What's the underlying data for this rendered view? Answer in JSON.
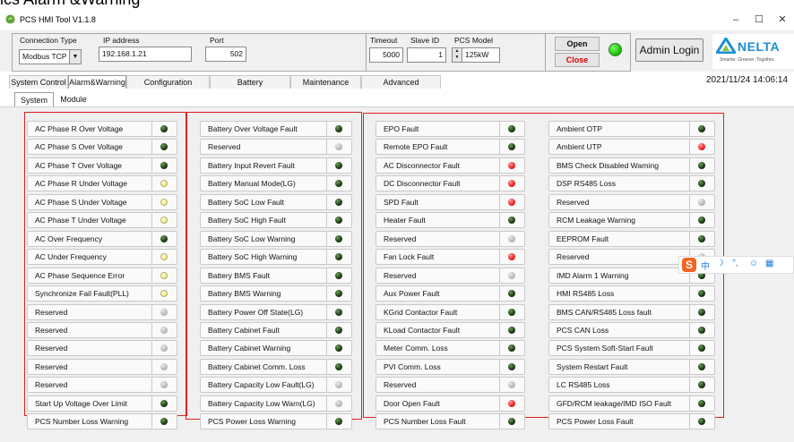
{
  "page_heading_cut": "ics Alarm &Warning",
  "window": {
    "title": "PCS HMI Tool V1.1.8",
    "controls": {
      "minimize": "–",
      "maximize": "☐",
      "close": "✕"
    }
  },
  "connection": {
    "type_label": "Connection Type",
    "type_value": "Modbus TCP",
    "ip_label": "IP address",
    "ip_value": "192.168.1.21",
    "port_label": "Port",
    "port_value": "502",
    "timeout_label": "Timeout",
    "timeout_value": "5000",
    "slave_label": "Slave ID",
    "slave_value": "1",
    "model_label": "PCS Model",
    "model_value": "125kW",
    "open_label": "Open",
    "close_label": "Close",
    "status_color": "#1cc60a"
  },
  "admin_login": "Admin Login",
  "brand": {
    "name": "NELTA",
    "tagline": "Smarter. Greener. Together."
  },
  "tabs": [
    "System Control",
    "Alarm&Warning",
    "Configuration",
    "Battery",
    "Maintenance",
    "Advanced"
  ],
  "active_tab": "Alarm&Warning",
  "datetime": "2021/11/24 14:06:14",
  "subtabs": [
    "System",
    "Module"
  ],
  "active_subtab": "System",
  "led_colors": {
    "dark": "#1a3a12",
    "gray": "#b8b8b8",
    "yellow": "#f2ee8a",
    "red": "#ee2222"
  },
  "columns": [
    {
      "items": [
        {
          "label": "AC Phase R Over Voltage",
          "state": "dark"
        },
        {
          "label": "AC Phase S Over Voltage",
          "state": "dark"
        },
        {
          "label": "AC Phase T Over Voltage",
          "state": "dark"
        },
        {
          "label": "AC Phase R Under Voltage",
          "state": "yellow"
        },
        {
          "label": "AC Phase S Under Voltage",
          "state": "yellow"
        },
        {
          "label": "AC Phase T Under Voltage",
          "state": "yellow"
        },
        {
          "label": "AC Over Frequency",
          "state": "dark"
        },
        {
          "label": "AC Under Frequency",
          "state": "yellow"
        },
        {
          "label": "AC Phase Sequence Error",
          "state": "yellow"
        },
        {
          "label": "Synchronize Fail Fault(PLL)",
          "state": "yellow"
        },
        {
          "label": "Reserved",
          "state": "gray"
        },
        {
          "label": "Reserved",
          "state": "gray"
        },
        {
          "label": "Reserved",
          "state": "gray"
        },
        {
          "label": "Reserved",
          "state": "gray"
        },
        {
          "label": "Reserved",
          "state": "gray"
        },
        {
          "label": "Start Up Voltage Over Limit",
          "state": "dark"
        },
        {
          "label": "PCS Number Loss Warning",
          "state": "dark"
        }
      ]
    },
    {
      "items": [
        {
          "label": "Battery Over Voltage Fault",
          "state": "dark"
        },
        {
          "label": "Reserved",
          "state": "gray"
        },
        {
          "label": "Battery Input Revert Fault",
          "state": "dark"
        },
        {
          "label": "Battery Manual Mode(LG)",
          "state": "dark"
        },
        {
          "label": "Battery SoC Low Fault",
          "state": "dark"
        },
        {
          "label": "Battery SoC High Fault",
          "state": "dark"
        },
        {
          "label": "Battery SoC Low Warning",
          "state": "dark"
        },
        {
          "label": "Battery SoC High Warning",
          "state": "dark"
        },
        {
          "label": "Battery BMS Fault",
          "state": "dark"
        },
        {
          "label": "Battery BMS Warning",
          "state": "dark"
        },
        {
          "label": "Battery Power Off State(LG)",
          "state": "dark"
        },
        {
          "label": "Battery Cabinet Fault",
          "state": "dark"
        },
        {
          "label": "Battery Cabinet Warning",
          "state": "dark"
        },
        {
          "label": "Battery Cabinet Comm. Loss",
          "state": "dark"
        },
        {
          "label": "Battery Capacity Low Fault(LG)",
          "state": "gray"
        },
        {
          "label": "Battery Capacity Low Warn(LG)",
          "state": "gray"
        },
        {
          "label": "PCS Power Loss Warning",
          "state": "dark"
        }
      ]
    },
    {
      "items": [
        {
          "label": "EPO Fault",
          "state": "dark"
        },
        {
          "label": "Remote EPO Fault",
          "state": "dark"
        },
        {
          "label": "AC Disconnector Fault",
          "state": "red"
        },
        {
          "label": "DC Disconnector Fault",
          "state": "red"
        },
        {
          "label": "SPD Fault",
          "state": "red"
        },
        {
          "label": "Heater Fault",
          "state": "dark"
        },
        {
          "label": "Reserved",
          "state": "gray"
        },
        {
          "label": "Fan Lock Fault",
          "state": "red"
        },
        {
          "label": "Reserved",
          "state": "gray"
        },
        {
          "label": "Aux Power Fault",
          "state": "dark"
        },
        {
          "label": "KGrid Contactor Fault",
          "state": "dark"
        },
        {
          "label": "KLoad Contactor Fault",
          "state": "dark"
        },
        {
          "label": "Meter Comm. Loss",
          "state": "dark"
        },
        {
          "label": "PVI Comm. Loss",
          "state": "dark"
        },
        {
          "label": "Reserved",
          "state": "gray"
        },
        {
          "label": "Door Open Fault",
          "state": "red"
        },
        {
          "label": "PCS Number Loss Fault",
          "state": "dark"
        }
      ]
    },
    {
      "items": [
        {
          "label": "Ambient OTP",
          "state": "dark"
        },
        {
          "label": "Ambient UTP",
          "state": "red"
        },
        {
          "label": "BMS Check Disabled Warning",
          "state": "dark"
        },
        {
          "label": "DSP RS485 Loss",
          "state": "dark"
        },
        {
          "label": "Reserved",
          "state": "gray"
        },
        {
          "label": "RCM Leakage Warning",
          "state": "dark"
        },
        {
          "label": "EEPROM Fault",
          "state": "dark"
        },
        {
          "label": "Reserved",
          "state": "gray"
        },
        {
          "label": "IMD Alarm 1 Warning",
          "state": "dark"
        },
        {
          "label": "HMI RS485 Loss",
          "state": "dark"
        },
        {
          "label": "BMS CAN/RS485 Loss fault",
          "state": "dark"
        },
        {
          "label": "PCS CAN Loss",
          "state": "dark"
        },
        {
          "label": "PCS System Soft-Start Fault",
          "state": "dark"
        },
        {
          "label": "System Restart Fault",
          "state": "dark"
        },
        {
          "label": "LC RS485 Loss",
          "state": "dark"
        },
        {
          "label": "GFD/RCM leakage/IMD ISO Fault",
          "state": "dark"
        },
        {
          "label": "PCS Power Loss Fault",
          "state": "dark"
        }
      ]
    }
  ],
  "ime_bar": {
    "logo": "S",
    "icons": [
      "中",
      "☽",
      "°,",
      "☺",
      "▦"
    ]
  }
}
